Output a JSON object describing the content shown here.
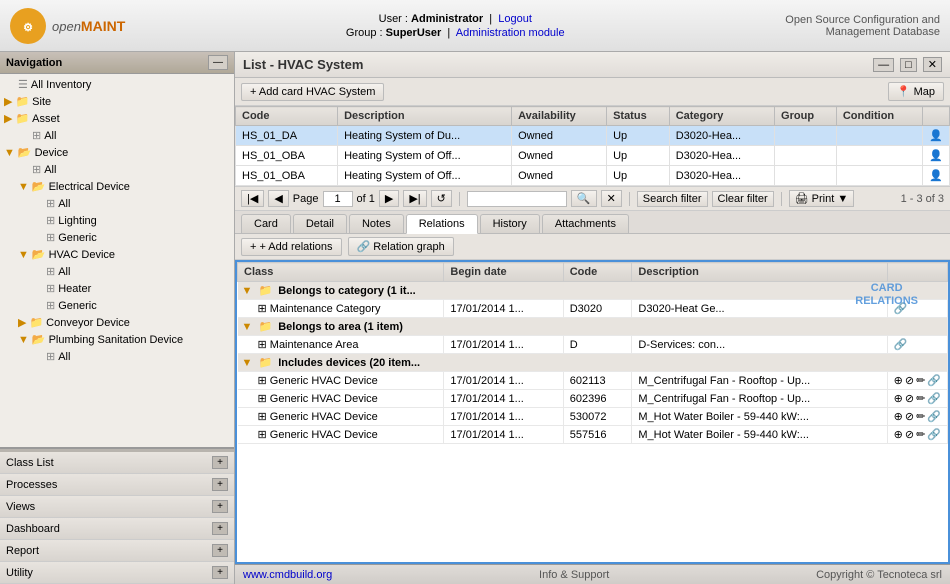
{
  "header": {
    "logo_text": "open",
    "logo_text2": "MAINT",
    "user_label": "User :",
    "user_name": "Administrator",
    "logout_label": "Logout",
    "group_label": "Group :",
    "group_name": "SuperUser",
    "admin_module": "Administration module",
    "right_line1": "Open Source Configuration and",
    "right_line2": "Management Database"
  },
  "sidebar": {
    "title": "Navigation",
    "items": [
      {
        "label": "All Inventory",
        "indent": 1,
        "type": "item"
      },
      {
        "label": "Site",
        "indent": 0,
        "type": "folder"
      },
      {
        "label": "Asset",
        "indent": 0,
        "type": "folder"
      },
      {
        "label": "All",
        "indent": 1,
        "type": "item"
      },
      {
        "label": "Device",
        "indent": 0,
        "type": "folder"
      },
      {
        "label": "All",
        "indent": 1,
        "type": "item"
      },
      {
        "label": "Electrical Device",
        "indent": 1,
        "type": "folder"
      },
      {
        "label": "All",
        "indent": 2,
        "type": "item"
      },
      {
        "label": "Lighting",
        "indent": 2,
        "type": "item"
      },
      {
        "label": "Generic",
        "indent": 2,
        "type": "item"
      },
      {
        "label": "HVAC Device",
        "indent": 1,
        "type": "folder"
      },
      {
        "label": "All",
        "indent": 2,
        "type": "item"
      },
      {
        "label": "Heater",
        "indent": 2,
        "type": "item"
      },
      {
        "label": "Generic",
        "indent": 2,
        "type": "item"
      },
      {
        "label": "Conveyor Device",
        "indent": 1,
        "type": "folder"
      },
      {
        "label": "Plumbing Sanitation Device",
        "indent": 1,
        "type": "folder"
      },
      {
        "label": "All",
        "indent": 2,
        "type": "item"
      }
    ],
    "bottom_items": [
      {
        "label": "Class List"
      },
      {
        "label": "Processes"
      },
      {
        "label": "Views"
      },
      {
        "label": "Dashboard"
      },
      {
        "label": "Report"
      },
      {
        "label": "Utility"
      }
    ]
  },
  "list": {
    "title": "List - HVAC System",
    "add_card_label": "+ Add card HVAC System",
    "map_label": "📍 Map",
    "columns": [
      "Code",
      "Description",
      "Availability",
      "Status",
      "Category",
      "Group",
      "Condition"
    ],
    "rows": [
      {
        "code": "HS_01_DA",
        "desc": "Heating System of Du...",
        "avail": "Owned",
        "status": "Up",
        "cat": "D3020-Hea...",
        "group": "",
        "cond": ""
      },
      {
        "code": "HS_01_OBA",
        "desc": "Heating System of Off...",
        "avail": "Owned",
        "status": "Up",
        "cat": "D3020-Hea...",
        "group": "",
        "cond": ""
      },
      {
        "code": "HS_01_OBA",
        "desc": "Heating System of Off...",
        "avail": "Owned",
        "status": "Up",
        "cat": "D3020-Hea...",
        "group": "",
        "cond": ""
      }
    ],
    "pagination": {
      "page_label": "Page",
      "current_page": "1",
      "of_label": "of 1",
      "search_filter_label": "Search filter",
      "clear_filter_label": "Clear filter",
      "print_label": "Print",
      "count_label": "1 - 3 of 3"
    }
  },
  "tabs": {
    "items": [
      "Card",
      "Detail",
      "Notes",
      "Relations",
      "History",
      "Attachments"
    ],
    "active": "Relations"
  },
  "relations": {
    "add_label": "+ Add relations",
    "graph_label": "🔗 Relation graph",
    "columns": [
      "Class",
      "Begin date",
      "Code",
      "Description"
    ],
    "card_label": "CARD",
    "relations_label": "RELATIONS",
    "groups": [
      {
        "title": "Belongs to category (1 it...",
        "items": [
          {
            "class": "Maintenance Category",
            "date": "17/01/2014 1...",
            "code": "D3020",
            "desc": "D3020-Heat Ge..."
          }
        ]
      },
      {
        "title": "Belongs to area (1 item)",
        "items": [
          {
            "class": "Maintenance Area",
            "date": "17/01/2014 1...",
            "code": "D",
            "desc": "D-Services: con..."
          }
        ]
      },
      {
        "title": "Includes devices (20 item...",
        "items": [
          {
            "class": "Generic HVAC Device",
            "date": "17/01/2014 1...",
            "code": "602113",
            "desc": "M_Centrifugal Fan - Rooftop - Up..."
          },
          {
            "class": "Generic HVAC Device",
            "date": "17/01/2014 1...",
            "code": "602396",
            "desc": "M_Centrifugal Fan - Rooftop - Up..."
          },
          {
            "class": "Generic HVAC Device",
            "date": "17/01/2014 1...",
            "code": "530072",
            "desc": "M_Hot Water Boiler - 59-440 kW:..."
          },
          {
            "class": "Generic HVAC Device",
            "date": "17/01/2014 1...",
            "code": "557516",
            "desc": "M_Hot Water Boiler - 59-440 kW:..."
          }
        ]
      }
    ]
  },
  "statusbar": {
    "site_label": "www.cmdbuild.org",
    "info_label": "Info & Support",
    "copyright": "Copyright © Tecnoteca srl"
  }
}
